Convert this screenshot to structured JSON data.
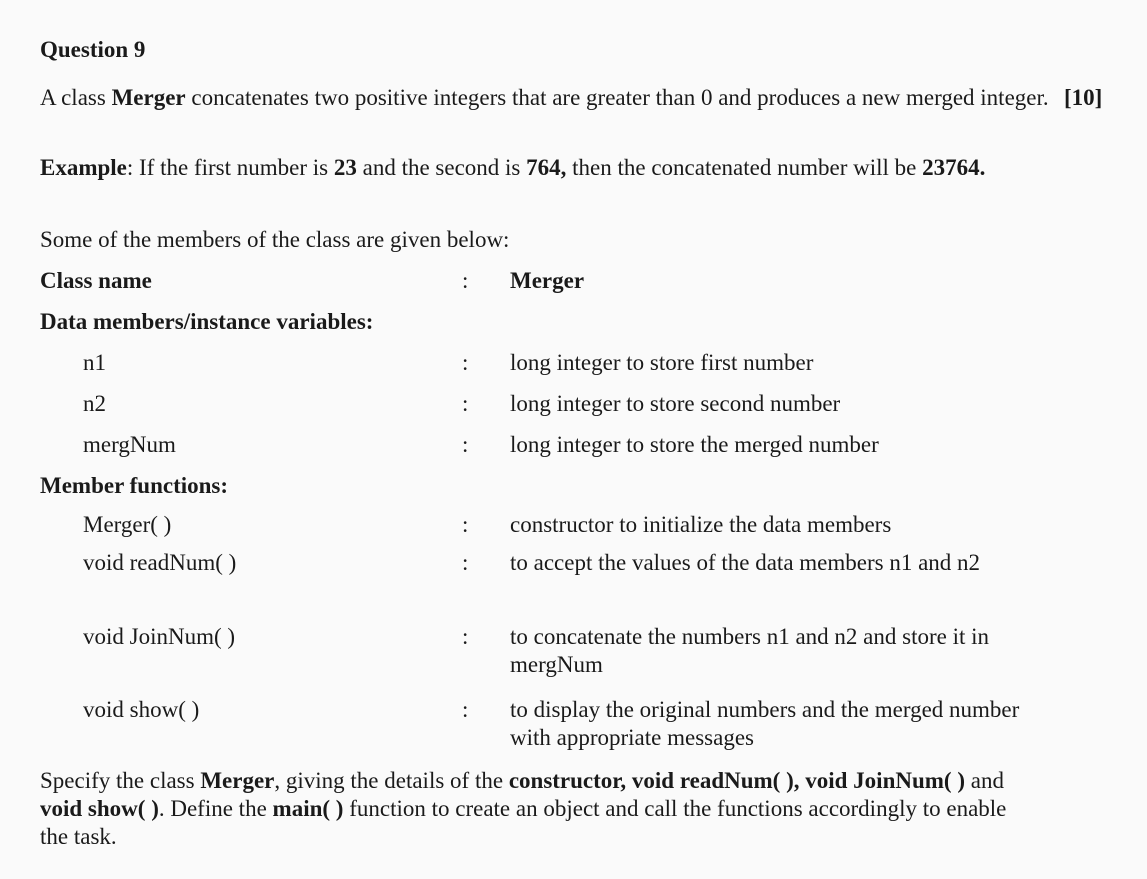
{
  "question": {
    "title": "Question 9",
    "marks": "[10]",
    "intro": {
      "t1": "A class ",
      "b1": "Merger",
      "t2": " concatenates two positive integers that are greater than 0 and produces a new merged integer."
    },
    "example": {
      "label": "Example",
      "t1": ": If the first number is ",
      "b1": "23",
      "t2": " and the second is ",
      "b2": "764,",
      "t3": " then the concatenated number will be ",
      "b3": "23764."
    },
    "members_intro": "Some of the members of the class are given below:"
  },
  "class_info": {
    "label": "Class name",
    "colon": ":",
    "value": "Merger"
  },
  "data_members": {
    "heading": "Data members/instance variables:",
    "items": [
      {
        "name": "n1",
        "colon": ":",
        "desc": "long integer to store first number"
      },
      {
        "name": "n2",
        "colon": ":",
        "desc": "long integer to store second number"
      },
      {
        "name": "mergNum",
        "colon": ":",
        "desc": "long integer to store the merged number"
      }
    ]
  },
  "member_functions": {
    "heading": "Member functions:",
    "items": [
      {
        "name": "Merger( )",
        "colon": ":",
        "desc": "constructor to initialize the data members"
      },
      {
        "name": "void readNum( )",
        "colon": ":",
        "desc": "to accept the values of the data members n1 and n2"
      },
      {
        "name": "void JoinNum( )",
        "colon": ":",
        "desc": "to concatenate the numbers n1 and n2 and store it in mergNum"
      },
      {
        "name": "void show( )",
        "colon": ":",
        "desc": "to display the original numbers and the merged number with appropriate messages"
      }
    ]
  },
  "closing": {
    "t1": "Specify the class ",
    "b1": "Merger",
    "t2": ", giving the details of the ",
    "b2": "constructor, void readNum( ), void JoinNum( )",
    "t3": " and ",
    "b3": "void show( )",
    "t4": ". Define the ",
    "b4": "main( )",
    "t5": " function to create an object and call the functions accordingly to enable the task."
  }
}
